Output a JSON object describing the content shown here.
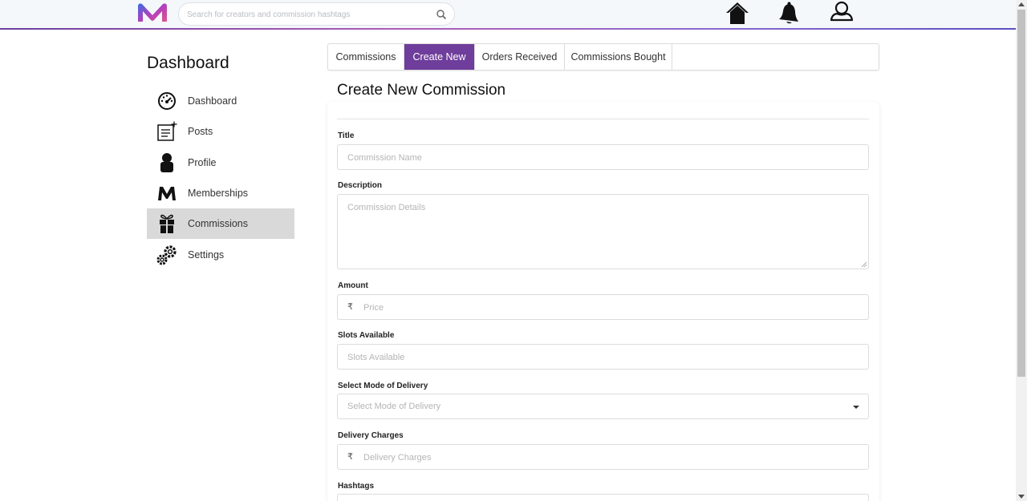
{
  "header": {
    "search_placeholder": "Search for creators and commission hashtags",
    "icons": [
      "logo-m",
      "search-icon",
      "home-icon",
      "bell-icon",
      "user-icon"
    ]
  },
  "sidebar": {
    "title": "Dashboard",
    "items": [
      {
        "label": "Dashboard",
        "icon": "speedometer-icon"
      },
      {
        "label": "Posts",
        "icon": "posts-icon"
      },
      {
        "label": "Profile",
        "icon": "profile-icon"
      },
      {
        "label": "Memberships",
        "icon": "memberships-icon"
      },
      {
        "label": "Commissions",
        "icon": "gift-icon",
        "active": true
      },
      {
        "label": "Settings",
        "icon": "gears-icon"
      }
    ]
  },
  "tabs": [
    {
      "label": "Commissions"
    },
    {
      "label": "Create New",
      "active": true
    },
    {
      "label": "Orders Received"
    },
    {
      "label": "Commissions Bought"
    }
  ],
  "form": {
    "title": "Create New Commission",
    "fields": {
      "title": {
        "label": "Title",
        "placeholder": "Commission Name"
      },
      "description": {
        "label": "Description",
        "placeholder": "Commission Details"
      },
      "amount": {
        "label": "Amount",
        "prefix": "₹",
        "placeholder": "Price"
      },
      "slots": {
        "label": "Slots Available",
        "placeholder": "Slots Available"
      },
      "delivery_mode": {
        "label": "Select Mode of Delivery",
        "placeholder": "Select Mode of Delivery"
      },
      "delivery_charges": {
        "label": "Delivery Charges",
        "prefix": "₹",
        "placeholder": "Delivery Charges"
      },
      "hashtags": {
        "label": "Hashtags"
      }
    }
  },
  "colors": {
    "accent": "#6f3d9b",
    "active_sidebar_bg": "#d9d9d9",
    "topbar_bg": "#f5f8fb"
  }
}
